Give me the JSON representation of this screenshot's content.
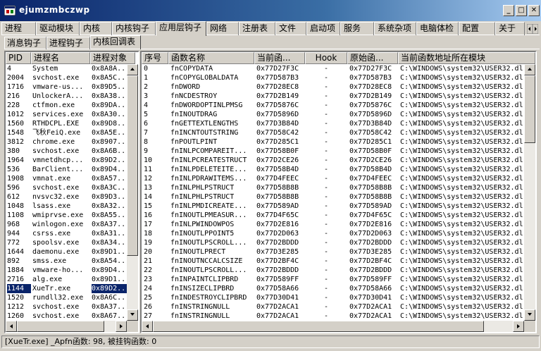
{
  "window": {
    "title": "ejumzmbczwp",
    "minimize_glyph": "_",
    "maximize_glyph": "□",
    "close_glyph": "✕"
  },
  "main_tabs": [
    "进程",
    "驱动模块",
    "内核",
    "内核钩子",
    "应用层钩子",
    "网络",
    "注册表",
    "文件",
    "启动项",
    "服务",
    "系统杂项",
    "电脑体检",
    "配置",
    "关于"
  ],
  "sub_tabs": [
    "消息钩子",
    "进程钩子",
    "内核回调表"
  ],
  "process_list": {
    "columns": [
      "PID",
      "进程名",
      "进程对象"
    ],
    "rows": [
      [
        "4",
        "System",
        "0x8A8A..."
      ],
      [
        "2004",
        "svchost.exe",
        "0x8A5C..."
      ],
      [
        "1716",
        "vmware-us...",
        "0x89D5..."
      ],
      [
        "216",
        "UnlockerA...",
        "0x8A38..."
      ],
      [
        "228",
        "ctfmon.exe",
        "0x89DA..."
      ],
      [
        "1012",
        "services.exe",
        "0x8A30..."
      ],
      [
        "1560",
        "RTHDCPL.EXE",
        "0x89D8..."
      ],
      [
        "1548",
        "飞秋FeiQ.exe",
        "0x8A5E..."
      ],
      [
        "3812",
        "chrome.exe",
        "0x8907..."
      ],
      [
        "380",
        "svchost.exe",
        "0x8A6B..."
      ],
      [
        "1964",
        "vmnetdhcp...",
        "0x89D2..."
      ],
      [
        "536",
        "BarClient...",
        "0x89D4..."
      ],
      [
        "1908",
        "vmnat.exe",
        "0x8A57..."
      ],
      [
        "596",
        "svchost.exe",
        "0x8A3C..."
      ],
      [
        "612",
        "nvsvc32.exe",
        "0x89D3..."
      ],
      [
        "1048",
        "lsass.exe",
        "0x8A32..."
      ],
      [
        "1108",
        "wmiprvse.exe",
        "0x8A55..."
      ],
      [
        "968",
        "winlogon.exe",
        "0x8A37..."
      ],
      [
        "944",
        "csrss.exe",
        "0x8A31..."
      ],
      [
        "772",
        "spoolsv.exe",
        "0x8A34..."
      ],
      [
        "1644",
        "daemonu.exe",
        "0x89D1..."
      ],
      [
        "892",
        "smss.exe",
        "0x8A54..."
      ],
      [
        "1884",
        "vmware-ho...",
        "0x89D4..."
      ],
      [
        "2716",
        "alg.exe",
        "0x89D1..."
      ],
      [
        "1144",
        "XueTr.exe",
        "0x89D2..."
      ],
      [
        "1520",
        "rundll32.exe",
        "0x8A6C..."
      ],
      [
        "1212",
        "svchost.exe",
        "0x8A37..."
      ],
      [
        "1260",
        "svchost.exe",
        "0x8A67..."
      ]
    ],
    "selected_index": 24
  },
  "callback_table": {
    "columns": [
      "序号",
      "函数名称",
      "当前函...",
      "Hook",
      "原始函...",
      "当前函数地址所在模块"
    ],
    "rows": [
      [
        "0",
        "fnCOPYDATA",
        "0x77D27F3C",
        "-",
        "0x77D27F3C",
        "C:\\WINDOWS\\system32\\USER32.dl"
      ],
      [
        "1",
        "fnCOPYGLOBALDATA",
        "0x77D587B3",
        "-",
        "0x77D587B3",
        "C:\\WINDOWS\\system32\\USER32.dl"
      ],
      [
        "2",
        "fnDWORD",
        "0x77D28EC8",
        "-",
        "0x77D28EC8",
        "C:\\WINDOWS\\system32\\USER32.dl"
      ],
      [
        "3",
        "fnNCDESTROY",
        "0x77D2B149",
        "-",
        "0x77D2B149",
        "C:\\WINDOWS\\system32\\USER32.dl"
      ],
      [
        "4",
        "fnDWORDOPTINLPMSG",
        "0x77D5876C",
        "-",
        "0x77D5876C",
        "C:\\WINDOWS\\system32\\USER32.dl"
      ],
      [
        "5",
        "fnINOUTDRAG",
        "0x77D5896D",
        "-",
        "0x77D5896D",
        "C:\\WINDOWS\\system32\\USER32.dl"
      ],
      [
        "6",
        "fnGETTEXTLENGTHS",
        "0x77D3B84D",
        "-",
        "0x77D3B84D",
        "C:\\WINDOWS\\system32\\USER32.dl"
      ],
      [
        "7",
        "fnINCNTOUTSTRING",
        "0x77D58C42",
        "-",
        "0x77D58C42",
        "C:\\WINDOWS\\system32\\USER32.dl"
      ],
      [
        "8",
        "fnPOUTLPINT",
        "0x77D285C1",
        "-",
        "0x77D285C1",
        "C:\\WINDOWS\\system32\\USER32.dl"
      ],
      [
        "9",
        "fnINLPCOMPAREIT...",
        "0x77D58B0F",
        "-",
        "0x77D58B0F",
        "C:\\WINDOWS\\system32\\USER32.dl"
      ],
      [
        "10",
        "fnINLPCREATESTRUCT",
        "0x77D2CE26",
        "-",
        "0x77D2CE26",
        "C:\\WINDOWS\\system32\\USER32.dl"
      ],
      [
        "11",
        "fnINLPDELETEITE...",
        "0x77D58B4D",
        "-",
        "0x77D58B4D",
        "C:\\WINDOWS\\system32\\USER32.dl"
      ],
      [
        "12",
        "fnINLPDRAWITEMS...",
        "0x77D4FEEC",
        "-",
        "0x77D4FEEC",
        "C:\\WINDOWS\\system32\\USER32.dl"
      ],
      [
        "13",
        "fnINLPHLPSTRUCT",
        "0x77D58B8B",
        "-",
        "0x77D58B8B",
        "C:\\WINDOWS\\system32\\USER32.dl"
      ],
      [
        "14",
        "fnINLPHLPSTRUCT",
        "0x77D58B8B",
        "-",
        "0x77D58B8B",
        "C:\\WINDOWS\\system32\\USER32.dl"
      ],
      [
        "15",
        "fnINLPMDICREATE...",
        "0x77D589AD",
        "-",
        "0x77D589AD",
        "C:\\WINDOWS\\system32\\USER32.dl"
      ],
      [
        "16",
        "fnINOUTLPMEASUR...",
        "0x77D4F65C",
        "-",
        "0x77D4F65C",
        "C:\\WINDOWS\\system32\\USER32.dl"
      ],
      [
        "17",
        "fnINLPWINDOWPOS",
        "0x77D2E816",
        "-",
        "0x77D2E816",
        "C:\\WINDOWS\\system32\\USER32.dl"
      ],
      [
        "18",
        "fnINOUTLPPOINT5",
        "0x77D2D063",
        "-",
        "0x77D2D063",
        "C:\\WINDOWS\\system32\\USER32.dl"
      ],
      [
        "19",
        "fnINOUTLPSCROLL...",
        "0x77D2BDDD",
        "-",
        "0x77D2BDDD",
        "C:\\WINDOWS\\system32\\USER32.dl"
      ],
      [
        "20",
        "fnINOUTLPRECT",
        "0x77D3E285",
        "-",
        "0x77D3E285",
        "C:\\WINDOWS\\system32\\USER32.dl"
      ],
      [
        "21",
        "fnINOUTNCCALCSIZE",
        "0x77D2BF4C",
        "-",
        "0x77D2BF4C",
        "C:\\WINDOWS\\system32\\USER32.dl"
      ],
      [
        "22",
        "fnINOUTLPSCROLL...",
        "0x77D2BDDD",
        "-",
        "0x77D2BDDD",
        "C:\\WINDOWS\\system32\\USER32.dl"
      ],
      [
        "23",
        "fnINPAINTCLIPBRD",
        "0x77D589FF",
        "-",
        "0x77D589FF",
        "C:\\WINDOWS\\system32\\USER32.dl"
      ],
      [
        "24",
        "fnINSIZECLIPBRD",
        "0x77D58A66",
        "-",
        "0x77D58A66",
        "C:\\WINDOWS\\system32\\USER32.dl"
      ],
      [
        "25",
        "fnINDESTROYCLIPBRD",
        "0x77D30D41",
        "-",
        "0x77D30D41",
        "C:\\WINDOWS\\system32\\USER32.dl"
      ],
      [
        "26",
        "fnINSTRINGNULL",
        "0x77D2ACA1",
        "-",
        "0x77D2ACA1",
        "C:\\WINDOWS\\system32\\USER32.dl"
      ],
      [
        "27",
        "fnINSTRINGNULL",
        "0x77D2ACA1",
        "-",
        "0x77D2ACA1",
        "C:\\WINDOWS\\system32\\USER32.dl"
      ]
    ]
  },
  "status_bar": {
    "text": "[XueTr.exe] _Apfn函数: 98, 被挂钩函数: 0"
  },
  "colors": {
    "selection": "#0a246a",
    "face": "#d4d0c8"
  }
}
